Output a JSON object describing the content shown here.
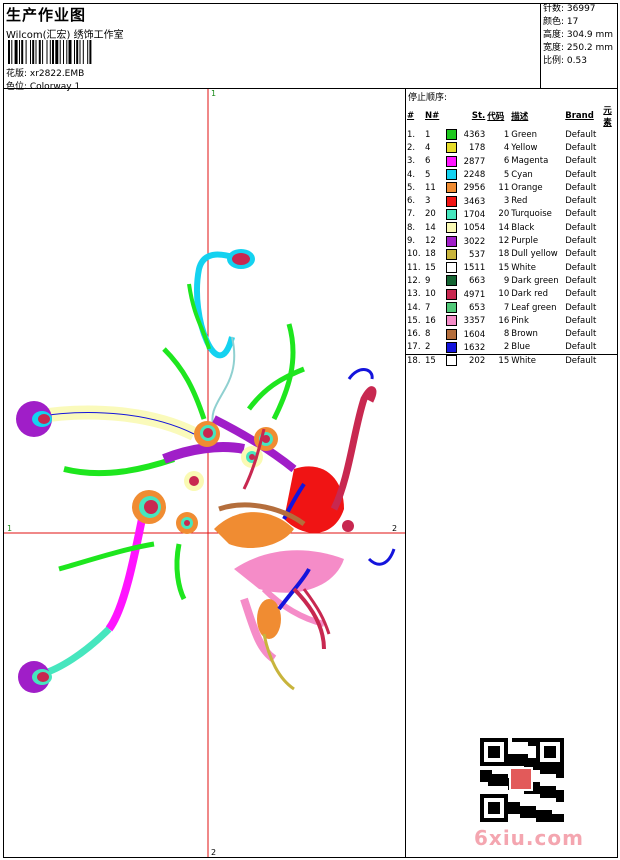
{
  "header": {
    "title": "生产作业图",
    "company": "Wilcom(汇宏) 绣饰工作室",
    "design": "花版:  xr2822.EMB",
    "colorway": "色位:  Colorway 1"
  },
  "stats": [
    "针数:  36997",
    "颜色:  17",
    "高度:  304.9 mm",
    "宽度:  250.2 mm",
    "比例:  0.53"
  ],
  "stop_sequence": {
    "title": "停止顺序:",
    "headers": [
      "#",
      "N#",
      "St.",
      "代码",
      "描述",
      "Brand",
      "元素"
    ],
    "rows": [
      {
        "idx": "1.",
        "n": "1",
        "color": "#1ec81e",
        "st": "4363",
        "code": "1",
        "desc": "Green",
        "brand": "Default"
      },
      {
        "idx": "2.",
        "n": "4",
        "color": "#e6dc28",
        "st": "178",
        "code": "4",
        "desc": "Yellow",
        "brand": "Default"
      },
      {
        "idx": "3.",
        "n": "6",
        "color": "#ff14ff",
        "st": "2877",
        "code": "6",
        "desc": "Magenta",
        "brand": "Default"
      },
      {
        "idx": "4.",
        "n": "5",
        "color": "#14d2f0",
        "st": "2248",
        "code": "5",
        "desc": "Cyan",
        "brand": "Default"
      },
      {
        "idx": "5.",
        "n": "11",
        "color": "#f08c32",
        "st": "2956",
        "code": "11",
        "desc": "Orange",
        "brand": "Default"
      },
      {
        "idx": "6.",
        "n": "3",
        "color": "#f01414",
        "st": "3463",
        "code": "3",
        "desc": "Red",
        "brand": "Default"
      },
      {
        "idx": "7.",
        "n": "20",
        "color": "#46e6be",
        "st": "1704",
        "code": "20",
        "desc": "Turquoise",
        "brand": "Default"
      },
      {
        "idx": "8.",
        "n": "14",
        "color": "#fafab4",
        "st": "1054",
        "code": "14",
        "desc": "Black",
        "brand": "Default"
      },
      {
        "idx": "9.",
        "n": "12",
        "color": "#a01ec8",
        "st": "3022",
        "code": "12",
        "desc": "Purple",
        "brand": "Default"
      },
      {
        "idx": "10.",
        "n": "18",
        "color": "#c8b43c",
        "st": "537",
        "code": "18",
        "desc": "Dull yellow",
        "brand": "Default"
      },
      {
        "idx": "11.",
        "n": "15",
        "color": "#ffffff",
        "st": "1511",
        "code": "15",
        "desc": "White",
        "brand": "Default"
      },
      {
        "idx": "12.",
        "n": "9",
        "color": "#146432",
        "st": "663",
        "code": "9",
        "desc": "Dark green",
        "brand": "Default"
      },
      {
        "idx": "13.",
        "n": "10",
        "color": "#c82850",
        "st": "4971",
        "code": "10",
        "desc": "Dark red",
        "brand": "Default"
      },
      {
        "idx": "14.",
        "n": "7",
        "color": "#50c878",
        "st": "653",
        "code": "7",
        "desc": "Leaf green",
        "brand": "Default"
      },
      {
        "idx": "15.",
        "n": "16",
        "color": "#f58cc8",
        "st": "3357",
        "code": "16",
        "desc": "Pink",
        "brand": "Default"
      },
      {
        "idx": "16.",
        "n": "8",
        "color": "#b46e3c",
        "st": "1604",
        "code": "8",
        "desc": "Brown",
        "brand": "Default"
      },
      {
        "idx": "17.",
        "n": "2",
        "color": "#1414dc",
        "st": "1632",
        "code": "2",
        "desc": "Blue",
        "brand": "Default"
      },
      {
        "idx": "18.",
        "n": "15",
        "color": "#ffffff",
        "st": "202",
        "code": "15",
        "desc": "White",
        "brand": "Default"
      }
    ]
  },
  "crosshair": {
    "top_label": "1",
    "left_label": "1",
    "right_label": "2",
    "bottom_label": "2"
  },
  "watermark": "6xiu.com",
  "colors": {
    "crosshair": "#e01010",
    "border": "#000000"
  }
}
